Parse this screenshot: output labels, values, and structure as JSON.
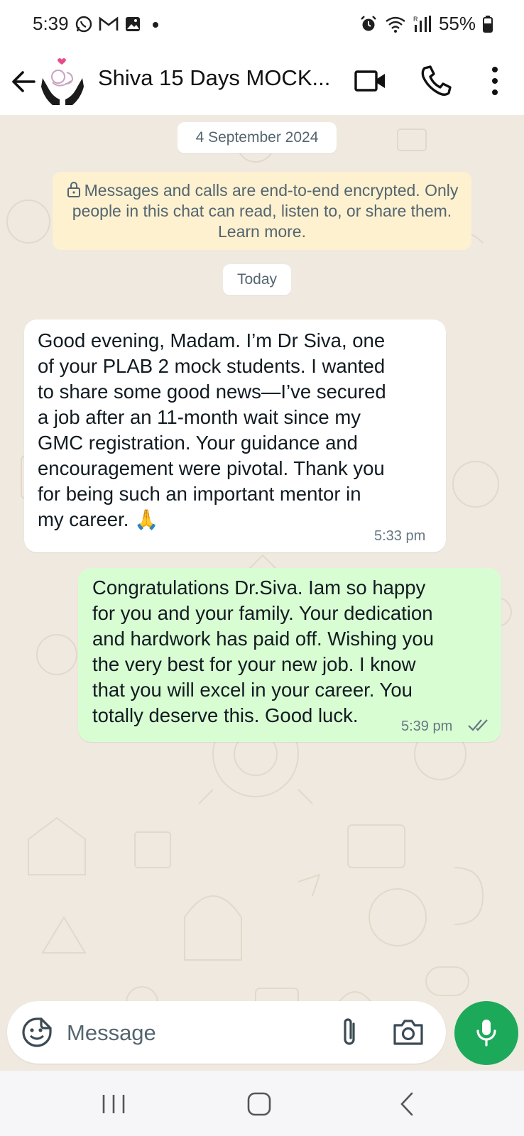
{
  "status_bar": {
    "time": "5:39",
    "notification_icons": [
      "whatsapp-icon",
      "gmail-icon",
      "gallery-icon",
      "dot-icon"
    ],
    "system_icons": [
      "alarm-icon",
      "wifi-icon",
      "signal-icon"
    ],
    "battery": "55%"
  },
  "header": {
    "title": "Shiva 15 Days MOCK...",
    "icons": [
      "back-arrow-icon",
      "video-call-icon",
      "voice-call-icon",
      "more-options-icon"
    ]
  },
  "chat": {
    "date_chip": "4 September 2024",
    "encryption_notice": "Messages and calls are end-to-end encrypted. Only people in this chat can read, listen to, or share them. Learn more.",
    "today_chip": "Today",
    "messages": [
      {
        "direction": "incoming",
        "text": "Good evening, Madam. I’m Dr Siva, one\nof your PLAB 2 mock students. I wanted\nto share some good news—I’ve secured\na job after an 11-month wait since my\nGMC registration. Your guidance and\nencouragement were pivotal. Thank you\nfor being such an important mentor in\nmy career. 🙏",
        "time": "5:33 pm"
      },
      {
        "direction": "outgoing",
        "text": "Congratulations Dr.Siva. Iam so happy\nfor you and your family. Your dedication\nand hardwork has paid off. Wishing you\nthe very best for your new job. I know\nthat you will excel in your career. You\ntotally deserve this. Good luck.",
        "time": "5:39 pm",
        "status": "read"
      }
    ]
  },
  "input_bar": {
    "placeholder": "Message",
    "icons": [
      "sticker-icon",
      "attach-icon",
      "camera-icon",
      "mic-icon"
    ]
  },
  "colors": {
    "accent_green": "#1da95a",
    "outgoing_bubble": "#d9fdd3",
    "encryption_banner": "#fdf1d0",
    "chat_background": "#efe9e0"
  }
}
